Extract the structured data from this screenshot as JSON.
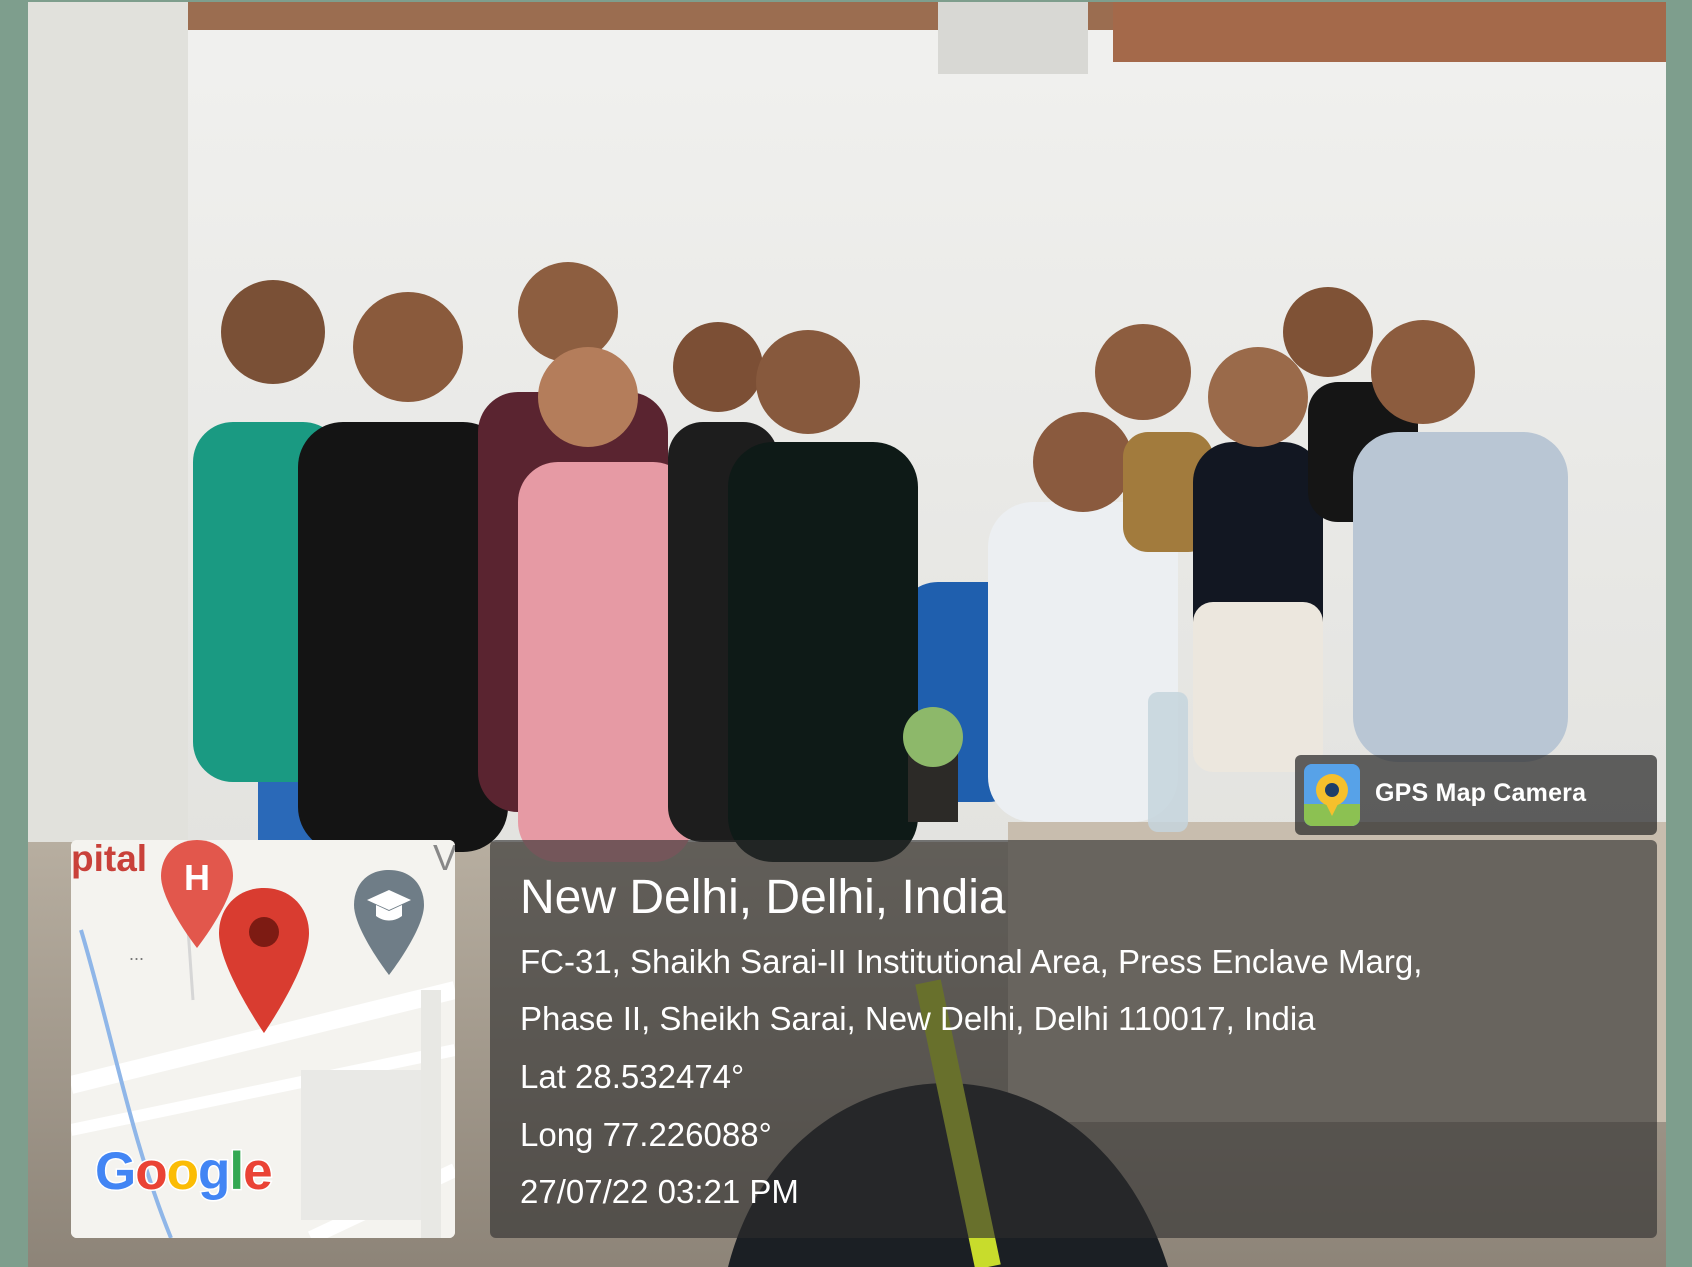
{
  "watermark": {
    "app_name": "GPS Map Camera",
    "icon": "gps-map-camera-icon"
  },
  "map": {
    "poi_partial_text": "pital",
    "partial_right_text": "V",
    "logo_letters": [
      "G",
      "o",
      "o",
      "g",
      "l",
      "e"
    ],
    "icons": [
      "hospital-marker-icon",
      "location-pin-icon",
      "school-marker-icon"
    ]
  },
  "location": {
    "title": "New Delhi, Delhi, India",
    "address_line1": "FC-31, Shaikh Sarai-II Institutional Area, Press Enclave Marg,",
    "address_line2": "Phase II, Sheikh Sarai, New Delhi, Delhi 110017, India",
    "latitude": "Lat 28.532474°",
    "longitude": "Long 77.226088°",
    "timestamp": "27/07/22 03:21 PM"
  },
  "colors": {
    "frame": "#7e9e8d",
    "wall": "#e9e9e6",
    "pin_red": "#d93c30",
    "school_grey": "#6f7d87"
  }
}
